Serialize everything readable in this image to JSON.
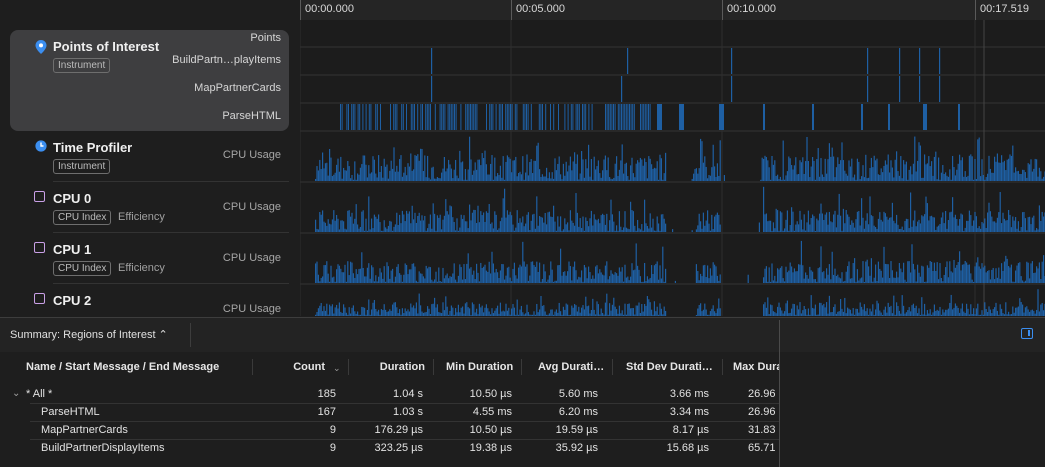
{
  "ruler": {
    "ticks": [
      "00:00.000",
      "00:05.000",
      "00:10.000",
      "00:17.519"
    ]
  },
  "tracks": {
    "poi": {
      "name": "Points of Interest",
      "badge": "Instrument",
      "lanes": [
        "Points",
        "BuildPartn…playItems",
        "MapPartnerCards",
        "ParseHTML"
      ],
      "icon": "location-pin-icon"
    },
    "time_profiler": {
      "name": "Time Profiler",
      "badge": "Instrument",
      "lane": "CPU Usage",
      "icon": "time-profiler-icon"
    },
    "cpu0": {
      "name": "CPU 0",
      "badge": "CPU Index",
      "sub": "Efficiency",
      "lane": "CPU Usage",
      "icon": "cpu-icon"
    },
    "cpu1": {
      "name": "CPU 1",
      "badge": "CPU Index",
      "sub": "Efficiency",
      "lane": "CPU Usage",
      "icon": "cpu-icon"
    },
    "cpu2": {
      "name": "CPU 2",
      "lane": "CPU Usage",
      "icon": "cpu-icon"
    }
  },
  "colors": {
    "accent": "#1e5fa3",
    "selection": "#3b8ef0"
  },
  "summary": {
    "label": "Summary: Regions of Interest ⌃"
  },
  "table": {
    "columns": [
      "Name / Start Message / End Message",
      "Count",
      "Duration",
      "Min Duration",
      "Avg Durati…",
      "Std Dev Durati…",
      "Max Dura"
    ],
    "rows": [
      {
        "name": "* All *",
        "count": "185",
        "duration": "1.04 s",
        "min": "10.50 µs",
        "avg": "5.60 ms",
        "std": "3.66 ms",
        "max": "26.96"
      },
      {
        "name": "ParseHTML",
        "count": "167",
        "duration": "1.03 s",
        "min": "4.55 ms",
        "avg": "6.20 ms",
        "std": "3.34 ms",
        "max": "26.96"
      },
      {
        "name": "MapPartnerCards",
        "count": "9",
        "duration": "176.29 µs",
        "min": "10.50 µs",
        "avg": "19.59 µs",
        "std": "8.17 µs",
        "max": "31.83"
      },
      {
        "name": "BuildPartnerDisplayItems",
        "count": "9",
        "duration": "323.25 µs",
        "min": "19.38 µs",
        "avg": "35.92 µs",
        "std": "15.68 µs",
        "max": "65.71"
      }
    ]
  }
}
